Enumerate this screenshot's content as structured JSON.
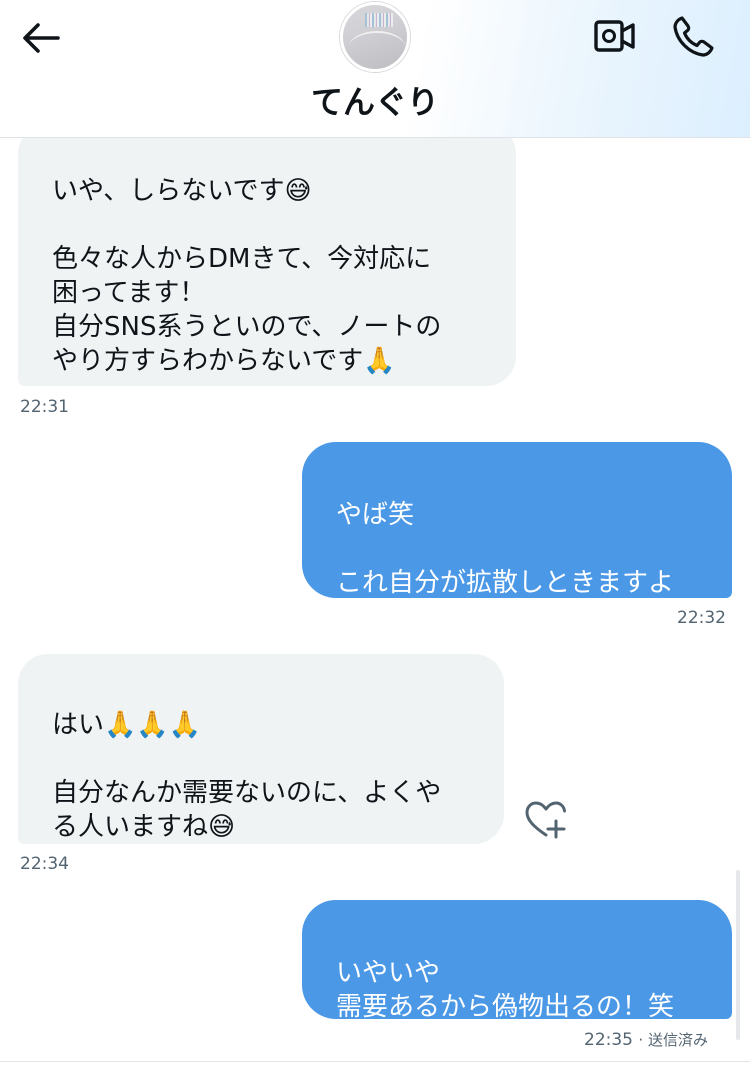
{
  "header": {
    "contact_name": "てんぐり",
    "icons": {
      "back": "back-arrow-icon",
      "video": "video-call-icon",
      "call": "phone-call-icon"
    }
  },
  "messages": [
    {
      "direction": "incoming",
      "text": "いや、しらないです😅\n\n色々な人からDMきて、今対応に\n困ってます！\n自分SNS系うといので、ノートの\nやり方すらわからないです🙏",
      "time": "22:31"
    },
    {
      "direction": "outgoing",
      "text": "やば笑\n\nこれ自分が拡散しときますよ",
      "time": "22:32"
    },
    {
      "direction": "incoming",
      "text": "はい🙏🙏🙏\n\n自分なんか需要ないのに、よくや\nる人いますね😅",
      "time": "22:34"
    },
    {
      "direction": "outgoing",
      "text": "いやいや\n需要あるから偽物出るの！笑",
      "time": "22:35",
      "status": "· 送信済み"
    }
  ],
  "colors": {
    "incoming_bubble": "#eff3f4",
    "outgoing_bubble": "#4b98e6",
    "timestamp": "#536471"
  }
}
